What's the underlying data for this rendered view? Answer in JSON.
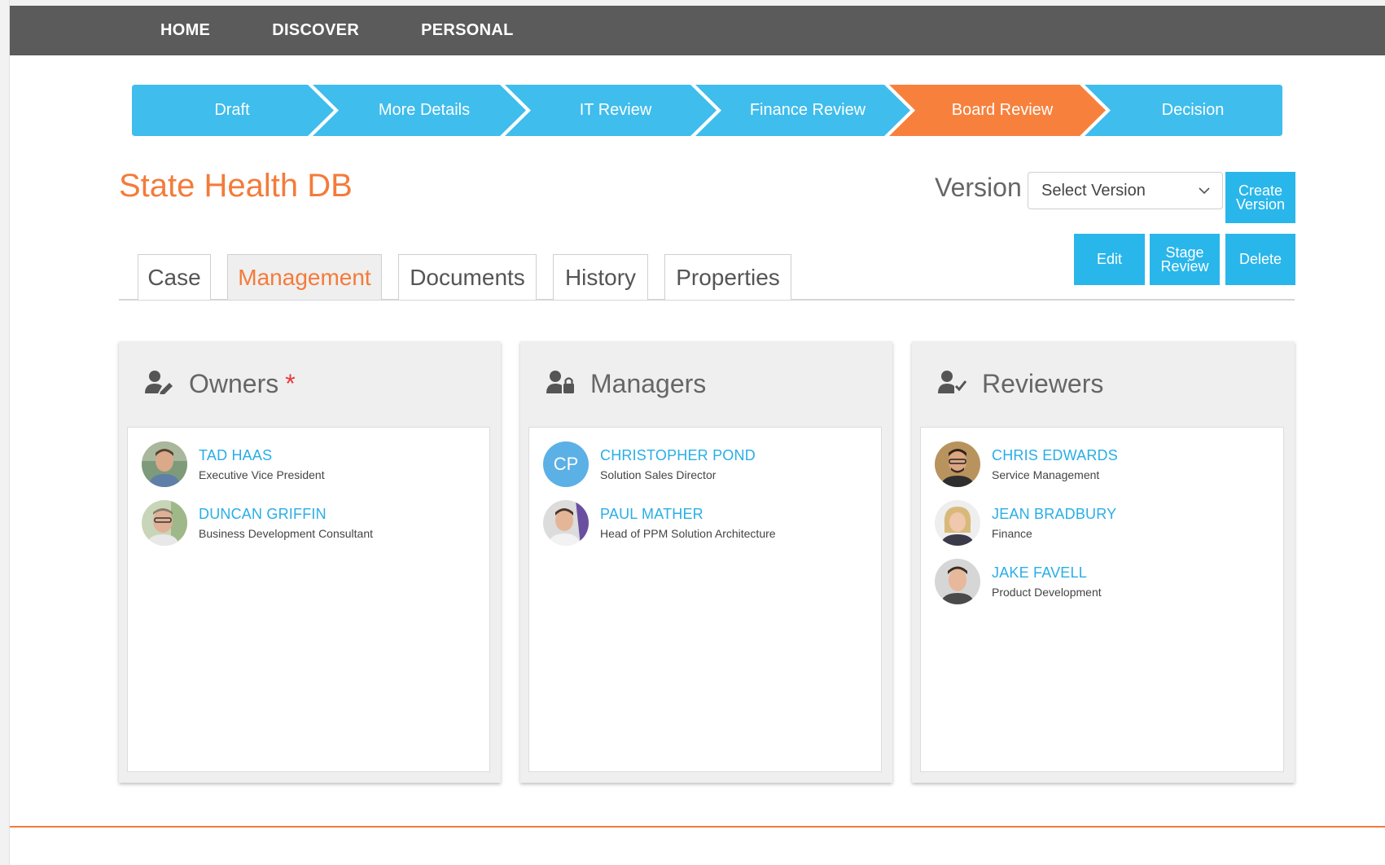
{
  "nav": {
    "items": [
      "HOME",
      "DISCOVER",
      "PERSONAL"
    ]
  },
  "stages": {
    "items": [
      {
        "label": "Draft",
        "active": false
      },
      {
        "label": "More Details",
        "active": false
      },
      {
        "label": "IT Review",
        "active": false
      },
      {
        "label": "Finance Review",
        "active": false
      },
      {
        "label": "Board Review",
        "active": true
      },
      {
        "label": "Decision",
        "active": false
      }
    ],
    "colors": {
      "default": "#3fbdec",
      "active": "#f7813c"
    }
  },
  "header": {
    "title": "State Health DB",
    "version_label": "Version",
    "version_select_value": "Select Version",
    "create_version_line1": "Create",
    "create_version_line2": "Version"
  },
  "actions": {
    "edit": "Edit",
    "stage_review_line1": "Stage",
    "stage_review_line2": "Review",
    "delete": "Delete"
  },
  "tabs": [
    {
      "label": "Case",
      "active": false
    },
    {
      "label": "Management",
      "active": true
    },
    {
      "label": "Documents",
      "active": false
    },
    {
      "label": "History",
      "active": false
    },
    {
      "label": "Properties",
      "active": false
    }
  ],
  "panels": {
    "owners": {
      "title": "Owners",
      "required_mark": "*",
      "icon": "user-edit-icon",
      "people": [
        {
          "name": "TAD HAAS",
          "role": "Executive Vice President"
        },
        {
          "name": "DUNCAN GRIFFIN",
          "role": "Business Development Consultant"
        }
      ]
    },
    "managers": {
      "title": "Managers",
      "icon": "user-lock-icon",
      "people": [
        {
          "name": "CHRISTOPHER POND",
          "role": "Solution Sales Director",
          "initials": "CP"
        },
        {
          "name": "PAUL MATHER",
          "role": "Head of PPM Solution Architecture"
        }
      ]
    },
    "reviewers": {
      "title": "Reviewers",
      "icon": "user-check-icon",
      "people": [
        {
          "name": "CHRIS EDWARDS",
          "role": "Service Management"
        },
        {
          "name": "JEAN BRADBURY",
          "role": "Finance"
        },
        {
          "name": "JAKE FAVELL",
          "role": "Product Development"
        }
      ]
    }
  },
  "colors": {
    "accent_orange": "#f47b3a",
    "button_blue": "#29b6ea",
    "link_blue": "#29aee6",
    "nav_bg": "#5a5b5a"
  }
}
